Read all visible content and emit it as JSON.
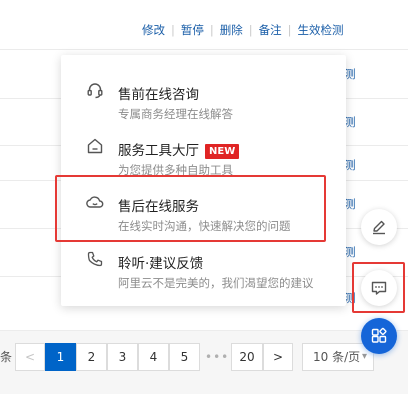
{
  "table": {
    "actions": [
      "修改",
      "暂停",
      "删除",
      "备注",
      "生效检测"
    ],
    "row_edge_link": "测"
  },
  "pagination": {
    "prefix": "条",
    "prev": "<",
    "pages": [
      "1",
      "2",
      "3",
      "4",
      "5"
    ],
    "active_page": "1",
    "ellipsis": "•••",
    "last_page": "20",
    "next": ">",
    "page_size": "10 条/页"
  },
  "support_menu": {
    "items": [
      {
        "title": "售前在线咨询",
        "subtitle": "专属商务经理在线解答",
        "icon": "headset-icon"
      },
      {
        "title": "服务工具大厅",
        "badge": "NEW",
        "subtitle": "为您提供多种自助工具",
        "icon": "home-icon"
      },
      {
        "title": "售后在线服务",
        "subtitle": "在线实时沟通，快速解决您的问题",
        "icon": "cloud-icon"
      },
      {
        "title": "聆听·建议反馈",
        "subtitle": "阿里云不是完美的，我们渴望您的建议",
        "icon": "phone-icon"
      }
    ]
  },
  "side_toolbar": {
    "buttons": [
      "edit-icon",
      "chat-icon",
      "apps-icon"
    ]
  },
  "colors": {
    "primary": "#0064c8",
    "link": "#1a5ea8",
    "highlight": "#e53935",
    "badge": "#e02424",
    "apps_button": "#1565d8"
  }
}
